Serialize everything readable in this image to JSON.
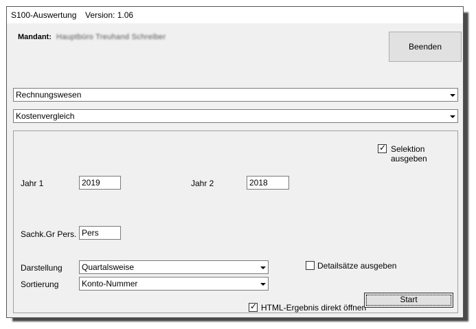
{
  "window": {
    "title": "S100-Auswertung",
    "version": "Version: 1.06"
  },
  "mandant": {
    "label": "Mandant:",
    "value": "Hauptbüro Treuhand Schreiber"
  },
  "buttons": {
    "beenden": "Beenden",
    "start": "Start"
  },
  "combos": {
    "bereich": "Rechnungswesen",
    "auswertung": "Kostenvergleich",
    "darstellung": "Quartalsweise",
    "sortierung": "Konto-Nummer"
  },
  "options": {
    "selektion_label": "Selektion ausgeben",
    "selektion_checked": true,
    "details_label": "Detailsätze ausgeben",
    "details_checked": false,
    "html_label": "HTML-Ergebnis direkt öffnen",
    "html_checked": true
  },
  "fields": {
    "jahr1_label": "Jahr 1",
    "jahr1_value": "2019",
    "jahr2_label": "Jahr 2",
    "jahr2_value": "2018",
    "sachk_label": "Sachk.Gr Pers.",
    "sachk_value": "Pers",
    "darstellung_label": "Darstellung",
    "sortierung_label": "Sortierung"
  }
}
